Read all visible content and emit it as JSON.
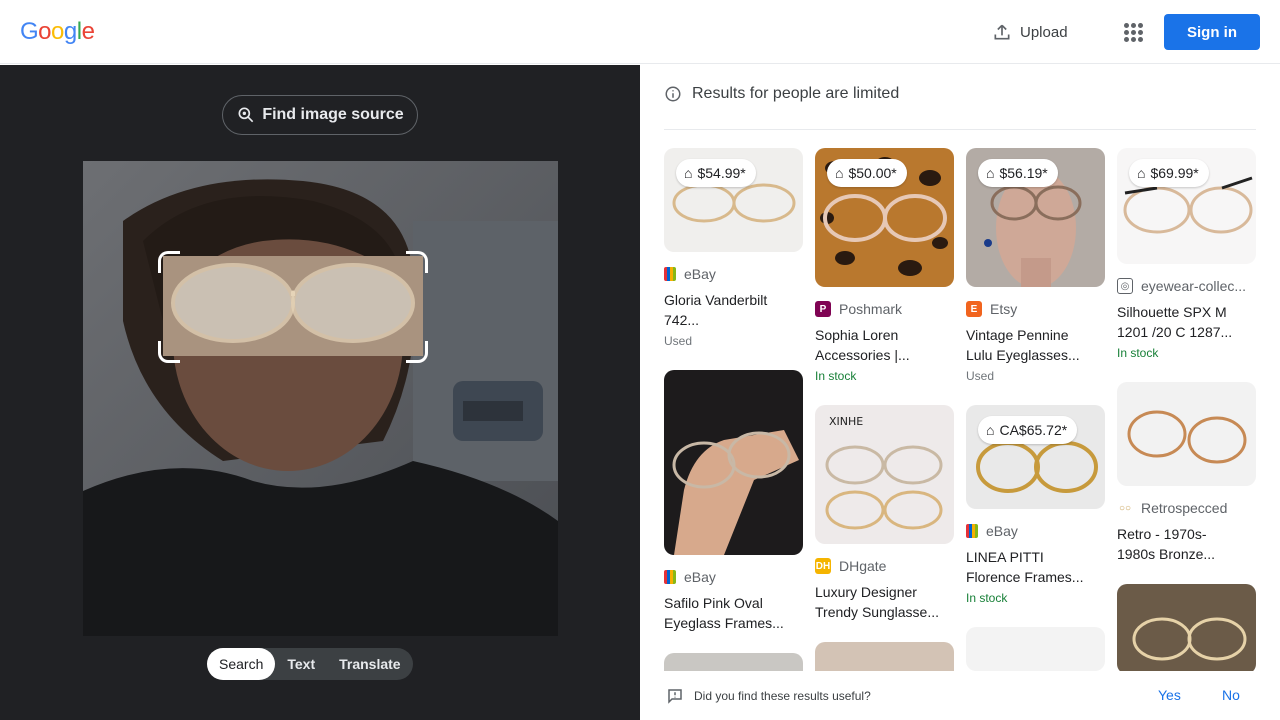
{
  "header": {
    "logo_letters": [
      "G",
      "o",
      "o",
      "g",
      "l",
      "e"
    ],
    "logo_colors": [
      "#4285f4",
      "#ea4335",
      "#fbbc05",
      "#4285f4",
      "#34a853",
      "#ea4335"
    ],
    "upload_label": "Upload",
    "signin_label": "Sign in",
    "accent": "#1a73e8"
  },
  "left": {
    "find_source_label": "Find image source",
    "modes": [
      "Search",
      "Text",
      "Translate"
    ],
    "active_mode": "Search"
  },
  "results": {
    "notice": "Results for people are limited",
    "cards": [
      {
        "price": "$54.99*",
        "source": "eBay",
        "favicon": "ebay",
        "title_lines": [
          "Gloria Vanderbilt",
          "742..."
        ],
        "status": "Used",
        "status_type": "used"
      },
      {
        "price": "$50.00*",
        "source": "Poshmark",
        "favicon": "poshmark",
        "title_lines": [
          "Sophia Loren",
          "Accessories |..."
        ],
        "status": "In stock",
        "status_type": "stock"
      },
      {
        "price": "$56.19*",
        "source": "Etsy",
        "favicon": "etsy",
        "title_lines": [
          "Vintage Pennine",
          "Lulu Eyeglasses..."
        ],
        "status": "Used",
        "status_type": "used"
      },
      {
        "price": "$69.99*",
        "source": "eyewear-collec...",
        "favicon": "eyewear",
        "title_lines": [
          "Silhouette SPX M",
          "1201 /20 C 1287..."
        ],
        "status": "In stock",
        "status_type": "stock"
      },
      {
        "price": "",
        "source": "eBay",
        "favicon": "ebay",
        "title_lines": [
          "Safilo Pink Oval",
          "Eyeglass Frames..."
        ],
        "status": "",
        "status_type": ""
      },
      {
        "price": "",
        "source": "DHgate",
        "favicon": "dhgate",
        "title_lines": [
          "Luxury Designer",
          "Trendy Sunglasse..."
        ],
        "status": "",
        "status_type": ""
      },
      {
        "price": "CA$65.72*",
        "source": "eBay",
        "favicon": "ebay",
        "title_lines": [
          "LINEA PITTI",
          "Florence Frames..."
        ],
        "status": "In stock",
        "status_type": "stock"
      },
      {
        "price": "",
        "source": "Retrospecced",
        "favicon": "retro",
        "title_lines": [
          "Retro - 1970s-",
          "1980s Bronze..."
        ],
        "status": "",
        "status_type": ""
      }
    ]
  },
  "feedback": {
    "question": "Did you find these results useful?",
    "yes": "Yes",
    "no": "No"
  }
}
